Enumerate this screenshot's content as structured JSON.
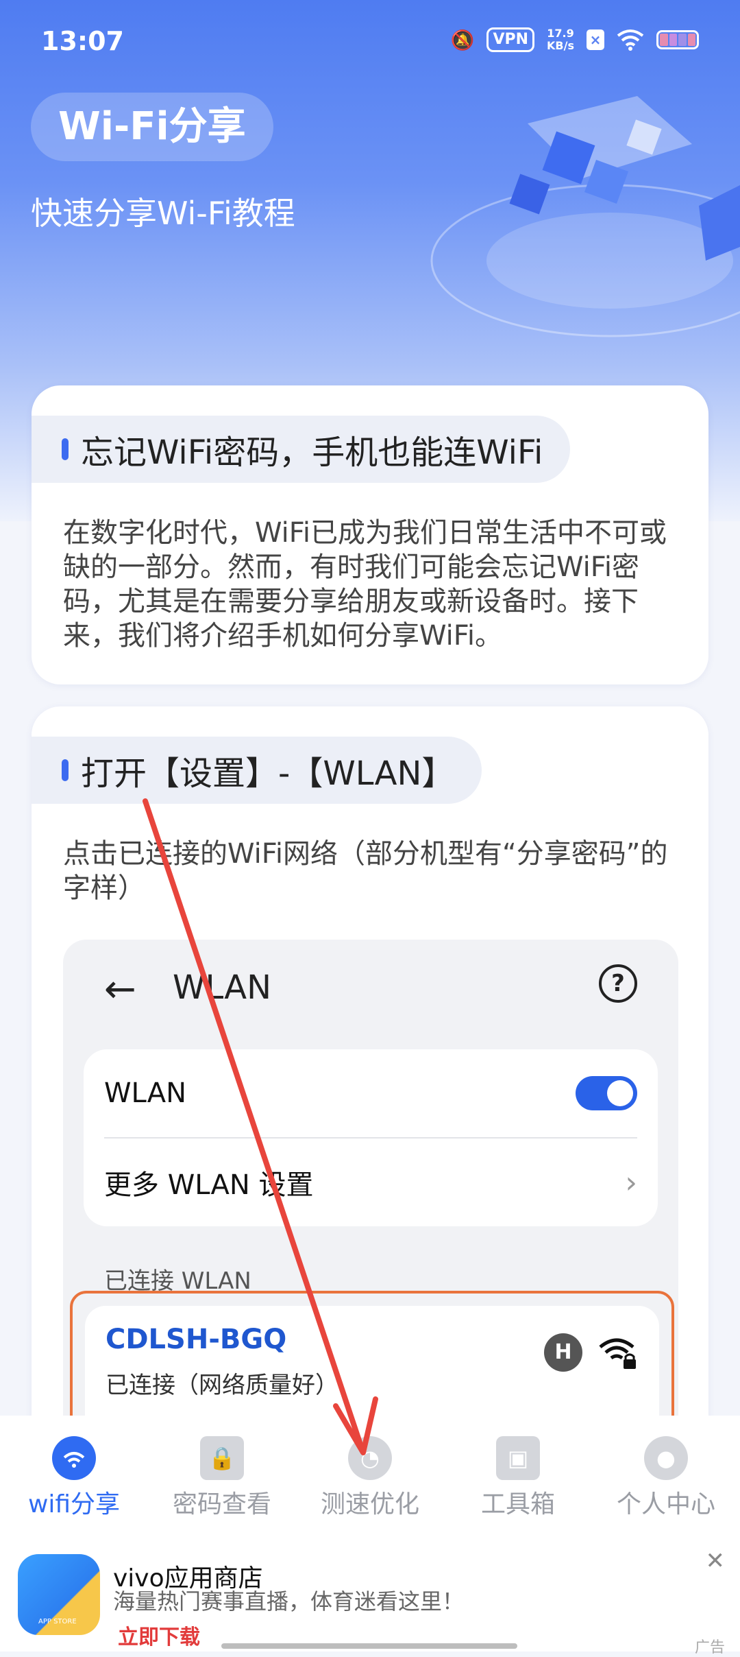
{
  "status_bar": {
    "time": "13:07",
    "vpn": "VPN",
    "net_speed_value": "17.9",
    "net_speed_unit": "KB/s",
    "icons": [
      "mute-bell-icon",
      "vpn-icon",
      "x-app-icon",
      "wifi-icon",
      "battery-icon"
    ]
  },
  "header": {
    "title": "Wi-Fi分享",
    "subtitle": "快速分享Wi-Fi教程"
  },
  "card1": {
    "heading": "忘记WiFi密码，手机也能连WiFi",
    "body": "在数字化时代，WiFi已成为我们日常生活中不可或缺的一部分。然而，有时我们可能会忘记WiFi密码，尤其是在需要分享给朋友或新设备时。接下来，我们将介绍手机如何分享WiFi。"
  },
  "card2": {
    "heading": "打开【设置】-【WLAN】",
    "body": "点击已连接的WiFi网络（部分机型有“分享密码”的字样）",
    "mock": {
      "title": "WLAN",
      "row1_label": "WLAN",
      "row1_toggle": "on",
      "row2_label": "更多 WLAN 设置",
      "section_label": "已连接 WLAN",
      "ssid": "CDLSH-BGQ",
      "conn_status": "已连接（网络质量好）",
      "hicon_text": "H"
    }
  },
  "tabbar": {
    "tabs": [
      {
        "label": "wifi分享",
        "icon": "wifi-share-icon",
        "active": true
      },
      {
        "label": "密码查看",
        "icon": "lock-icon",
        "active": false
      },
      {
        "label": "测速优化",
        "icon": "speedometer-icon",
        "active": false
      },
      {
        "label": "工具箱",
        "icon": "toolbox-icon",
        "active": false
      },
      {
        "label": "个人中心",
        "icon": "person-icon",
        "active": false
      }
    ]
  },
  "ad": {
    "app_name": "vivo应用商店",
    "desc": "海量热门赛事直播，体育迷看这里！",
    "cta": "立即下载",
    "logo_text": "APP STORE",
    "tag": "广告"
  },
  "colors": {
    "accent": "#2f6bf2",
    "annotation_arrow": "#e8453c",
    "highlight_border": "#e9733c"
  }
}
